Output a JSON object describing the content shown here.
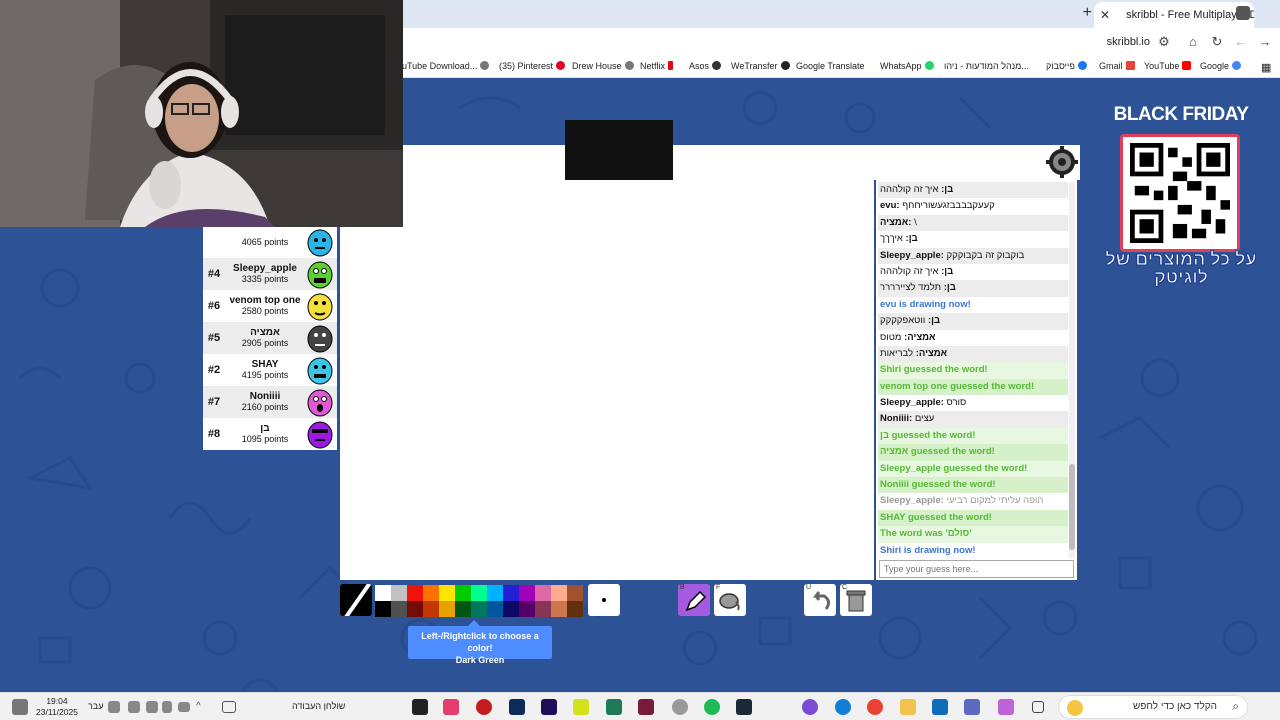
{
  "browser": {
    "active_tab_title": "skribbl - Free Multiplayer D",
    "url": "skribbl.io",
    "bookmarks": [
      "uTube Download...",
      "(35) Pinterest",
      "Drew House",
      "Netflix",
      "Asos",
      "WeTransfer",
      "Google Translate",
      "WhatsApp",
      "מנהל המודעות - ניהו...",
      "פייסבוק",
      "Gmail",
      "YouTube",
      "Google"
    ]
  },
  "players": [
    {
      "rank": "",
      "name": "",
      "points": "4065 points",
      "color": "#29b6e6"
    },
    {
      "rank": "#4",
      "name": "Sleepy_apple",
      "points": "3335 points",
      "color": "#5bd12f"
    },
    {
      "rank": "#6",
      "name": "venom top one",
      "points": "2580 points",
      "color": "#f4df3a"
    },
    {
      "rank": "#5",
      "name": "אמציה",
      "points": "2905 points",
      "color": "#444444"
    },
    {
      "rank": "#2",
      "name": "SHAY",
      "points": "4195 points",
      "color": "#3bc6e8"
    },
    {
      "rank": "#7",
      "name": "Noniiii",
      "points": "2160 points",
      "color": "#e05ad6"
    },
    {
      "rank": "#8",
      "name": "בן",
      "points": "1095 points",
      "color": "#9b19e0"
    }
  ],
  "chat": [
    {
      "nick": "בן:",
      "text": " איך זה קולההה",
      "style": "alt"
    },
    {
      "nick": "evu:",
      "text": " קעעקבבבבזגעשוריחחף",
      "style": "norm"
    },
    {
      "nick": "אמציה:",
      "text": " \\",
      "style": "alt"
    },
    {
      "nick": "בן:",
      "text": " איךךך",
      "style": "norm"
    },
    {
      "nick": "Sleepy_apple:",
      "text": " בוקבוק זה בקבוקקק",
      "style": "alt"
    },
    {
      "nick": "בן:",
      "text": " איך זה קולההה",
      "style": "norm"
    },
    {
      "nick": "בן:",
      "text": " תלמד לציירררר",
      "style": "alt"
    },
    {
      "nick": "",
      "text": "evu is drawing now!",
      "style": "blue"
    },
    {
      "nick": "בן:",
      "text": " ווטאפקקקק",
      "style": "alt"
    },
    {
      "nick": "אמציה:",
      "text": " מטוס",
      "style": "norm"
    },
    {
      "nick": "אמציה:",
      "text": " לבריאות",
      "style": "alt"
    },
    {
      "nick": "",
      "text": "Shiri guessed the word!",
      "style": "green plain"
    },
    {
      "nick": "",
      "text": "venom top one guessed the word!",
      "style": "green alt"
    },
    {
      "nick": "Sleepy_apple:",
      "text": " סורס",
      "style": "norm"
    },
    {
      "nick": "Noniiii:",
      "text": " עצים",
      "style": "alt"
    },
    {
      "nick": "",
      "text": "בן guessed the word!",
      "style": "green plain"
    },
    {
      "nick": "",
      "text": "אמציה guessed the word!",
      "style": "green alt"
    },
    {
      "nick": "",
      "text": "Sleepy_apple guessed the word!",
      "style": "green plain"
    },
    {
      "nick": "",
      "text": "Noniiii guessed the word!",
      "style": "green alt"
    },
    {
      "nick": "Sleepy_apple:",
      "text": " הופה עליתי למקום רביעי",
      "style": "grey"
    },
    {
      "nick": "",
      "text": "SHAY guessed the word!",
      "style": "green alt"
    },
    {
      "nick": "",
      "text": "The word was 'סולם'",
      "style": "green plain"
    },
    {
      "nick": "",
      "text": "Shiri is drawing now!",
      "style": "blue"
    }
  ],
  "guess_placeholder": "Type your guess here...",
  "palette_colors": [
    "#ffffff",
    "#c1c1c1",
    "#ef130b",
    "#ff7100",
    "#ffe400",
    "#00cc00",
    "#00ff91",
    "#00b2ff",
    "#231fd3",
    "#a300ba",
    "#df69a7",
    "#ffac8e",
    "#a0522d",
    "#000000",
    "#505050",
    "#740b07",
    "#c23800",
    "#e8a200",
    "#005510",
    "#00785d",
    "#00569e",
    "#0e0865",
    "#550069",
    "#873554",
    "#cc774d",
    "#63300d"
  ],
  "tool_keys": {
    "pen": "B",
    "fill": "F",
    "undo": "U",
    "clear": "C"
  },
  "tooltip": {
    "line1": "Left-/Rightclick to choose a color!",
    "line2": "Dark Green"
  },
  "promo": {
    "title": "BLACK FRIDAY",
    "subtitle": "על כל המוצרים של לוגיטק"
  },
  "taskbar": {
    "time": "19:04",
    "date": "23/11/2025",
    "lang": "עבר",
    "desktop": "שולחן העבודה",
    "search": "הקלד כאן כדי לחפש"
  }
}
